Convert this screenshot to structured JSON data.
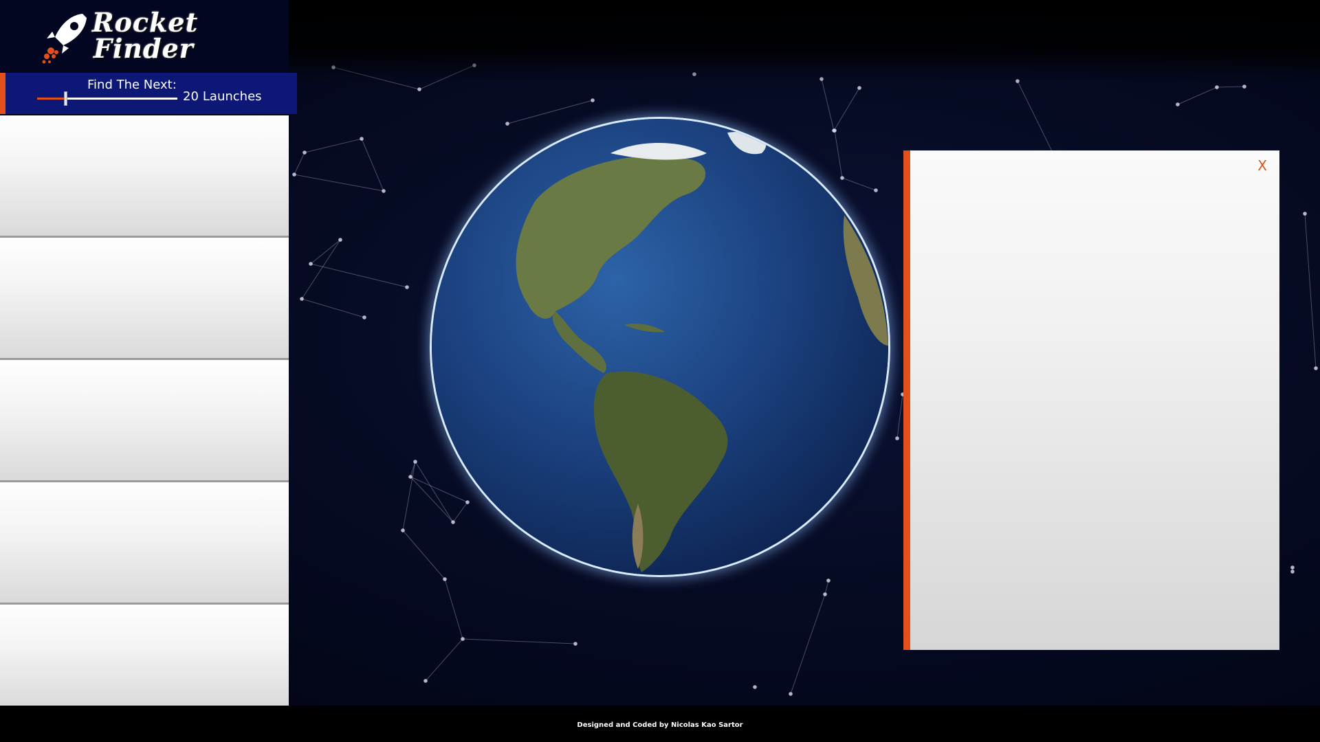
{
  "app": {
    "logo_line1": "Rocket",
    "logo_line2": "Finder",
    "logo_icon": "rocket-icon"
  },
  "finder": {
    "label": "Find The Next:",
    "slider_value": 20,
    "slider_max": 100,
    "count": "20",
    "unit": "Launches"
  },
  "launches": [
    {
      "id": "card-1"
    },
    {
      "id": "card-2"
    },
    {
      "id": "card-3"
    },
    {
      "id": "card-4"
    },
    {
      "id": "card-5"
    }
  ],
  "detail": {
    "close_label": "X"
  },
  "footer": {
    "credit": "Designed and Coded by Nicolas Kao Sartor"
  },
  "colors": {
    "accent": "#e2511c",
    "navy": "#0c1776",
    "background": "#03061a"
  }
}
